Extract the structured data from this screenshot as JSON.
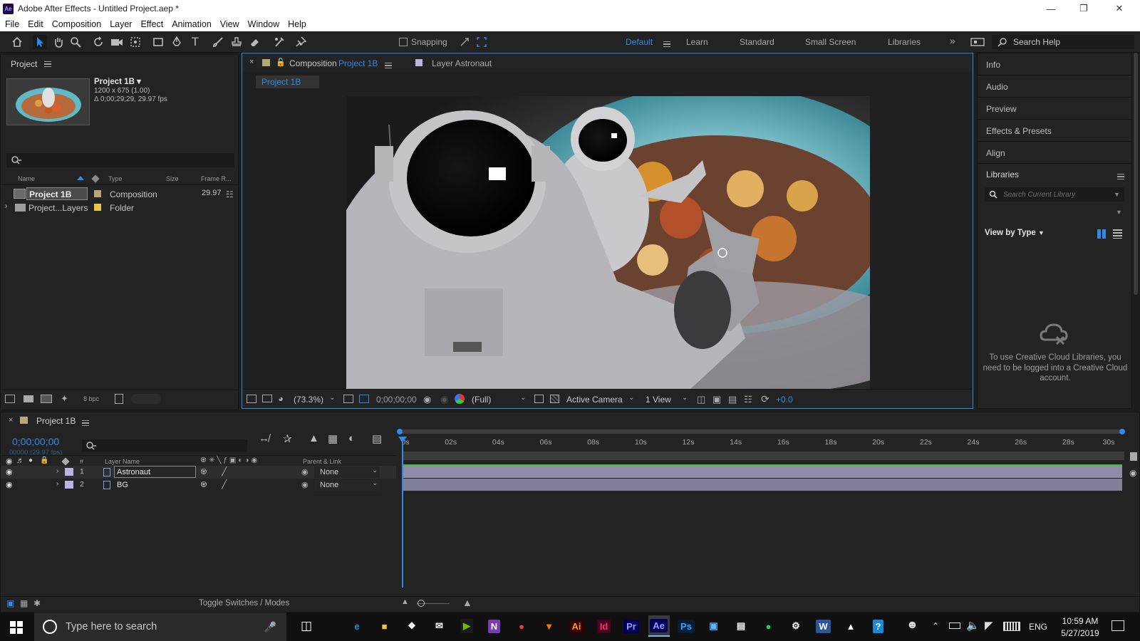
{
  "window": {
    "title": "Adobe After Effects - Untitled Project.aep *",
    "app_icon": "Ae"
  },
  "menu": [
    "File",
    "Edit",
    "Composition",
    "Layer",
    "Effect",
    "Animation",
    "View",
    "Window",
    "Help"
  ],
  "toolbar": {
    "snapping_label": "Snapping",
    "workspaces": [
      "Default",
      "Learn",
      "Standard",
      "Small Screen",
      "Libraries"
    ],
    "active_workspace": "Default",
    "search_help": "Search Help"
  },
  "project": {
    "panel_title": "Project",
    "item_name": "Project 1B ▾",
    "item_dims": "1200 x 675 (1.00)",
    "item_duration": "Δ 0;00;29;29, 29.97 fps",
    "columns": [
      "Name",
      "Type",
      "Size",
      "Frame R..."
    ],
    "rows": [
      {
        "name": "Project 1B",
        "type": "Composition",
        "size": "",
        "fps": "29.97",
        "color": "#b7a87a"
      },
      {
        "name": "Project...Layers",
        "type": "Folder",
        "size": "",
        "fps": "",
        "color": "#e6c64a"
      }
    ],
    "bpc": "8 bpc"
  },
  "comp": {
    "tab_label_prefix": "Composition",
    "tab_comp_name": "Project 1B",
    "layer_tab": "Layer  Astronaut",
    "breadcrumb": "Project 1B",
    "zoom": "(73.3%)",
    "timecode": "0;00;00;00",
    "resolution": "(Full)",
    "camera": "Active Camera",
    "views": "1 View",
    "exposure": "+0.0"
  },
  "right_panel": {
    "items": [
      "Info",
      "Audio",
      "Preview",
      "Effects & Presets",
      "Align"
    ],
    "libraries_title": "Libraries",
    "search_placeholder": "Search Current Library",
    "view_by": "View by Type",
    "cc_message": "To use Creative Cloud Libraries, you need to be logged into a Creative Cloud account."
  },
  "timeline": {
    "tab": "Project 1B",
    "timecode": "0;00;00;00",
    "frames": "00000 (29.97 fps)",
    "col_num": "#",
    "col_layer": "Layer Name",
    "col_parent": "Parent & Link",
    "layers": [
      {
        "num": "1",
        "name": "Astronaut",
        "parent": "None",
        "color": "#b9b4e3"
      },
      {
        "num": "2",
        "name": "BG",
        "parent": "None",
        "color": "#b9b4e3"
      }
    ],
    "ruler": [
      "0s",
      "02s",
      "04s",
      "06s",
      "08s",
      "10s",
      "12s",
      "14s",
      "16s",
      "18s",
      "20s",
      "22s",
      "24s",
      "26s",
      "28s",
      "30s"
    ],
    "toggle": "Toggle Switches / Modes"
  },
  "taskbar": {
    "search_placeholder": "Type here to search",
    "apps": [
      {
        "label": "e",
        "color": "#1f8fe0",
        "bg": "transparent"
      },
      {
        "label": "■",
        "color": "#f5c242",
        "bg": "transparent"
      },
      {
        "label": "❖",
        "color": "#ffffff",
        "bg": "transparent"
      },
      {
        "label": "✉",
        "color": "#ffffff",
        "bg": "transparent"
      },
      {
        "label": "▶",
        "color": "#76b900",
        "bg": "#1a1a1a"
      },
      {
        "label": "N",
        "color": "#ffffff",
        "bg": "#7a3ab5"
      },
      {
        "label": "●",
        "color": "#e84335",
        "bg": "transparent"
      },
      {
        "label": "▼",
        "color": "#ff7a00",
        "bg": "transparent"
      },
      {
        "label": "Ai",
        "color": "#ff9a00",
        "bg": "#330000"
      },
      {
        "label": "Id",
        "color": "#ff3366",
        "bg": "#49021f"
      },
      {
        "label": "Pr",
        "color": "#9999ff",
        "bg": "#00005b"
      },
      {
        "label": "Ae",
        "color": "#9999ff",
        "bg": "#00005b"
      },
      {
        "label": "Ps",
        "color": "#31a8ff",
        "bg": "#001e36"
      },
      {
        "label": "▣",
        "color": "#5fb7ff",
        "bg": "transparent"
      },
      {
        "label": "▤",
        "color": "#ffffff",
        "bg": "transparent"
      },
      {
        "label": "●",
        "color": "#1ed760",
        "bg": "transparent"
      },
      {
        "label": "⚙",
        "color": "#ffffff",
        "bg": "transparent"
      },
      {
        "label": "W",
        "color": "#ffffff",
        "bg": "#2b579a"
      },
      {
        "label": "▲",
        "color": "#ffffff",
        "bg": "transparent"
      },
      {
        "label": "?",
        "color": "#ffffff",
        "bg": "#1a8ad4"
      }
    ],
    "lang": "ENG",
    "time": "10:59 AM",
    "date": "5/27/2019"
  },
  "colors": {
    "accent": "#2d8ceb",
    "panel": "#232323",
    "bg": "#1d1d1d",
    "layerbar": "#8f8ba9",
    "playhead": "#2d8ceb"
  }
}
